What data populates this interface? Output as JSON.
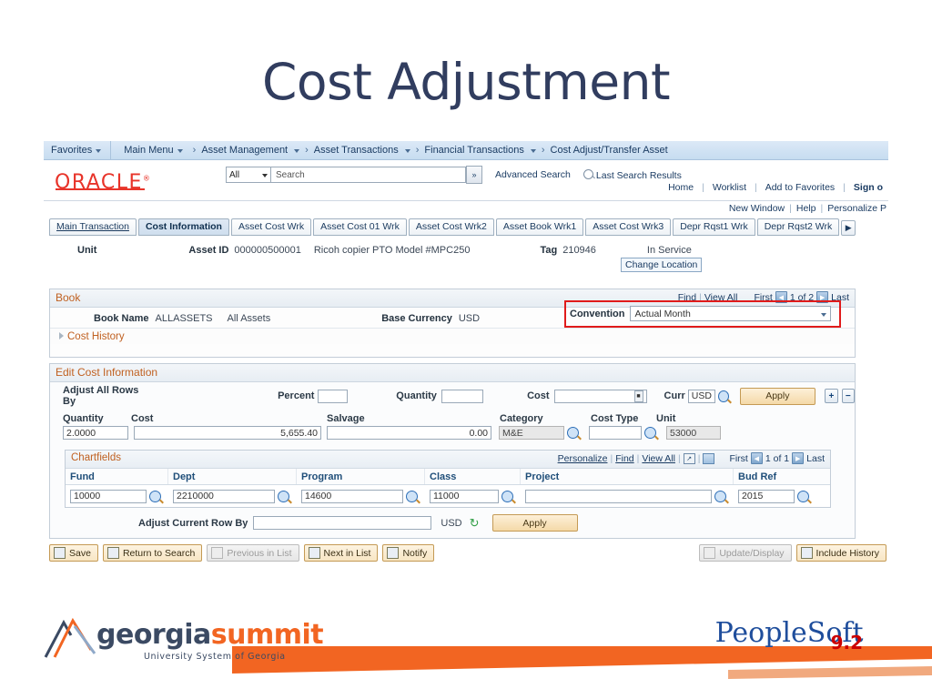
{
  "slide": {
    "title": "Cost Adjustment"
  },
  "navbar": {
    "favorites": "Favorites",
    "main_menu": "Main Menu",
    "breadcrumbs": [
      "Asset Management",
      "Asset Transactions",
      "Financial Transactions",
      "Cost Adjust/Transfer Asset"
    ]
  },
  "header": {
    "logo": "ORACLE",
    "search_scope": "All",
    "search_placeholder": "Search",
    "search_value": "",
    "advanced_search": "Advanced Search",
    "last_search_results": "Last Search Results",
    "links": [
      "Home",
      "Worklist",
      "Add to Favorites"
    ],
    "sign_out": "Sign o"
  },
  "window_links": {
    "new_window": "New Window",
    "help": "Help",
    "personalize": "Personalize P"
  },
  "tabs": [
    {
      "label": "Main Transaction",
      "active": false
    },
    {
      "label": "Cost Information",
      "active": true
    },
    {
      "label": "Asset Cost Wrk",
      "active": false
    },
    {
      "label": "Asset Cost 01 Wrk",
      "active": false
    },
    {
      "label": "Asset Cost Wrk2",
      "active": false
    },
    {
      "label": "Asset Book Wrk1",
      "active": false
    },
    {
      "label": "Asset Cost Wrk3",
      "active": false
    },
    {
      "label": "Depr Rqst1 Wrk",
      "active": false
    },
    {
      "label": "Depr Rqst2 Wrk",
      "active": false
    }
  ],
  "tab_next_icon": "chevron-right-icon",
  "asset": {
    "unit_label": "Unit",
    "unit_value": "",
    "asset_id_label": "Asset ID",
    "asset_id_value": "000000500001",
    "description": "Ricoh copier PTO Model #MPC250",
    "tag_label": "Tag",
    "tag_value": "210946",
    "status": "In Service",
    "change_location": "Change Location"
  },
  "book": {
    "group_title": "Book",
    "find": "Find",
    "view_all": "View All",
    "first": "First",
    "pager": "1 of 2",
    "last": "Last",
    "book_name_label": "Book Name",
    "book_name_value": "ALLASSETS",
    "book_desc": "All Assets",
    "base_currency_label": "Base Currency",
    "base_currency_value": "USD",
    "cost_history": "Cost History",
    "convention_label": "Convention",
    "convention_value": "Actual Month",
    "highlight_color": "#e01b1b"
  },
  "edit_cost": {
    "group_title": "Edit Cost Information",
    "adjust_all_rows_by": "Adjust All Rows By",
    "percent_label": "Percent",
    "percent_value": "",
    "quantity_label": "Quantity",
    "quantity_value": "",
    "cost_label": "Cost",
    "cost_value": "",
    "curr_label": "Curr",
    "curr_value": "USD",
    "apply_label": "Apply",
    "add_row": "+",
    "delete_row": "−"
  },
  "cost_row": {
    "columns": [
      "Quantity",
      "Cost",
      "Salvage",
      "Category",
      "Cost Type",
      "Unit"
    ],
    "quantity": "2.0000",
    "cost": "5,655.40",
    "salvage": "0.00",
    "category": "M&E",
    "cost_type": "",
    "unit": "53000"
  },
  "chartfields": {
    "group_title": "Chartfields",
    "personalize": "Personalize",
    "find": "Find",
    "view_all": "View All",
    "first": "First",
    "pager": "1 of 1",
    "last": "Last",
    "columns": [
      "Fund",
      "Dept",
      "Program",
      "Class",
      "Project",
      "Bud Ref"
    ],
    "values": [
      "10000",
      "2210000",
      "14600",
      "11000",
      "",
      "2015"
    ]
  },
  "adjust_current_row": {
    "label": "Adjust Current Row By",
    "value": "",
    "currency": "USD",
    "refresh_icon": "recycle-icon",
    "apply_label": "Apply"
  },
  "toolbar": {
    "save": "Save",
    "return_to_search": "Return to Search",
    "previous_in_list": "Previous in List",
    "next_in_list": "Next in List",
    "notify": "Notify",
    "update_display": "Update/Display",
    "include_history": "Include History"
  },
  "footer": {
    "ga_word_1": "georgia",
    "ga_word_2": "summit",
    "ga_sub": "University System of Georgia",
    "ps_word": "PeopleSoft",
    "ps_version": "9.2",
    "accent_orange": "#f26522",
    "peoplesoft_blue": "#1f4e9c"
  }
}
